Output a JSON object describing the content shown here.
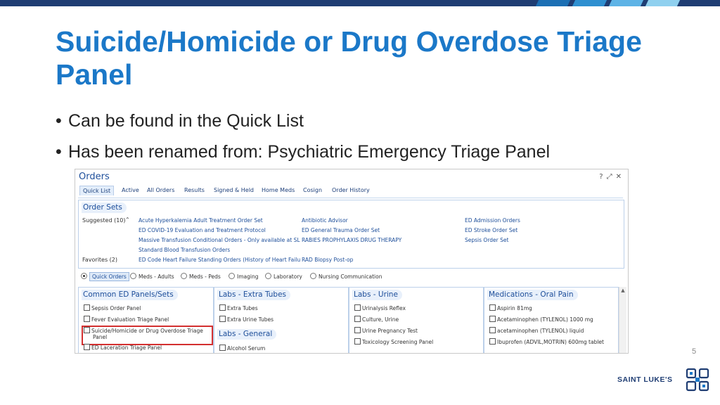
{
  "slide": {
    "title": "Suicide/Homicide or Drug Overdose Triage Panel",
    "bullets": [
      "Can be found in the Quick List",
      "Has been renamed from: Psychiatric Emergency Triage Panel"
    ],
    "page_number": "5",
    "brand": "SAINT LUKE'S"
  },
  "colors": {
    "title": "#1b78c8",
    "top_bar": "#1f3d73",
    "stripes": [
      "#1b6fb4",
      "#2e8fd0",
      "#5db3e6",
      "#8fd0ef"
    ],
    "highlight_box": "#d32f2f"
  },
  "orders": {
    "title": "Orders",
    "window_icons": [
      "help-icon",
      "expand-icon",
      "close-icon"
    ],
    "tabs": [
      "Quick List",
      "Active",
      "All Orders",
      "Results",
      "Signed & Held",
      "Home Meds",
      "Cosign",
      "Order History"
    ],
    "active_tab": "Quick List",
    "order_sets": {
      "header": "Order Sets",
      "suggested_label": "Suggested (10)",
      "favorites_label": "Favorites (2)",
      "col1": [
        "Acute Hyperkalemia Adult Treatment Order Set",
        "ED COVID-19 Evaluation and Treatment Protocol",
        "Massive Transfusion Conditional Orders - Only available at SL",
        "Standard Blood Transfusion Orders"
      ],
      "col2": [
        "Antibiotic Advisor",
        "ED General Trauma Order Set",
        "RABIES PROPHYLAXIS DRUG THERAPY"
      ],
      "col3": [
        "ED Admission Orders",
        "ED Stroke Order Set",
        "Sepsis Order Set"
      ],
      "favorites": [
        "ED Code Heart Failure Standing Orders (History of Heart Failu",
        "RAD Biopsy Post-op"
      ]
    },
    "filters": [
      "Quick Orders",
      "Meds - Adults",
      "Meds - Peds",
      "Imaging",
      "Laboratory",
      "Nursing Communication"
    ],
    "selected_filter": "Quick Orders",
    "panels": {
      "common": {
        "header": "Common ED Panels/Sets",
        "items": [
          "Sepsis Order Panel",
          "Fever Evaluation Triage Panel",
          "Suicide/Homicide or Drug Overdose Triage",
          "Panel",
          "ED Laceration Triage Panel"
        ]
      },
      "extra_tubes": {
        "header": "Labs - Extra Tubes",
        "items": [
          "Extra Tubes",
          "Extra Urine Tubes"
        ]
      },
      "general": {
        "header": "Labs - General",
        "items": [
          "Alcohol Serum"
        ]
      },
      "urine": {
        "header": "Labs - Urine",
        "items": [
          "Urinalysis Reflex",
          "Culture, Urine",
          "Urine Pregnancy Test",
          "Toxicology Screening Panel"
        ]
      },
      "oral_pain": {
        "header": "Medications - Oral Pain",
        "items": [
          "Aspirin 81mg",
          "Acetaminophen (TYLENOL) 1000 mg",
          "acetaminophen (TYLENOL) liquid",
          "Ibuprofen (ADVIL,MOTRIN) 600mg tablet"
        ]
      }
    }
  }
}
